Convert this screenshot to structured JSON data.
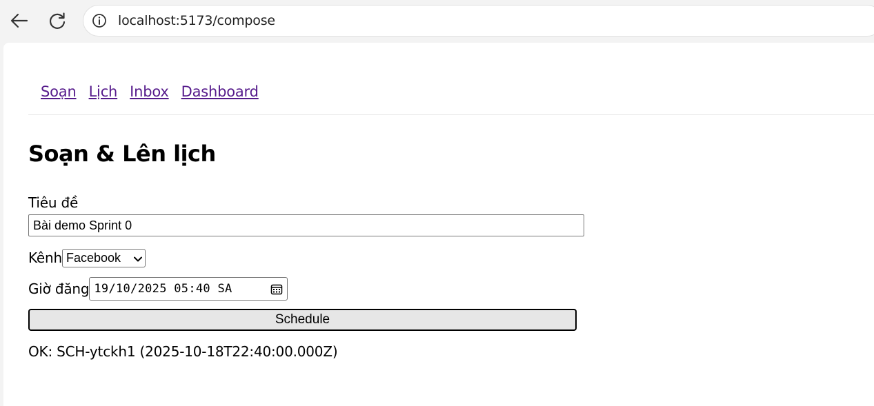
{
  "browser": {
    "url": "localhost:5173/compose",
    "icons": [
      "back-arrow-icon",
      "reload-icon",
      "site-info-icon"
    ]
  },
  "nav": {
    "links": [
      "Soạn",
      "Lịch",
      "Inbox",
      "Dashboard"
    ],
    "link_color": "#551a8b"
  },
  "page": {
    "title": "Soạn & Lên lịch"
  },
  "form": {
    "title_label": "Tiêu đề",
    "title_value": "Bài demo Sprint 0",
    "channel_label": "Kênh",
    "channel_value": "Facebook",
    "time_label": "Giờ đăng",
    "time_value": "19/10/2025 05:40 SA",
    "schedule_button": "Schedule"
  },
  "status": {
    "message": "OK: SCH-ytckh1 (2025-10-18T22:40:00.000Z)"
  }
}
